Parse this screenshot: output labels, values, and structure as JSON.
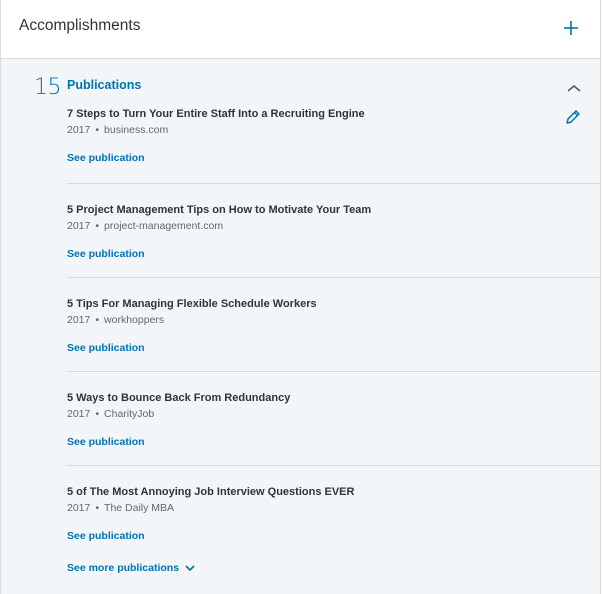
{
  "header": {
    "title": "Accomplishments",
    "add_icon": "plus-icon",
    "accent_color": "#0073b1"
  },
  "section": {
    "count": "15",
    "title": "Publications",
    "collapse_icon": "chevron-up-icon",
    "edit_icon": "pencil-icon",
    "separator": "•",
    "link_label": "See publication",
    "see_more_label": "See more publications",
    "see_more_icon": "chevron-down-icon"
  },
  "publications": [
    {
      "title": "7 Steps to Turn Your Entire Staff Into a Recruiting Engine",
      "year": "2017",
      "publisher": "business.com"
    },
    {
      "title": "5 Project Management Tips on How to Motivate Your Team",
      "year": "2017",
      "publisher": "project-management.com"
    },
    {
      "title": "5 Tips For Managing Flexible Schedule Workers",
      "year": "2017",
      "publisher": "workhoppers"
    },
    {
      "title": "5 Ways to Bounce Back From Redundancy",
      "year": "2017",
      "publisher": "CharityJob"
    },
    {
      "title": "5 of The Most Annoying Job Interview Questions EVER",
      "year": "2017",
      "publisher": "The Daily MBA"
    }
  ]
}
